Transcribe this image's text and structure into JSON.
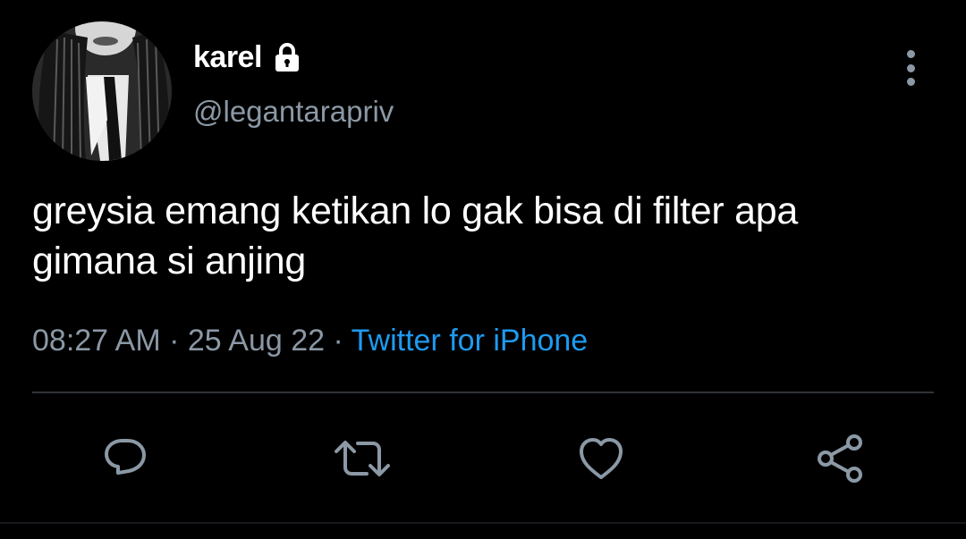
{
  "tweet": {
    "author": {
      "display_name": "karel",
      "handle": "@legantarapriv",
      "protected_icon": "lock-icon",
      "avatar": "profile-photo"
    },
    "text_line_1": "greysia emang ketikan lo gak bisa di filter apa",
    "text_line_2": "gimana si anjing",
    "time": "08:27 AM",
    "separator": "·",
    "date": "25 Aug 22",
    "source": "Twitter for iPhone"
  },
  "actions": [
    {
      "icon": "reply-icon"
    },
    {
      "icon": "retweet-icon"
    },
    {
      "icon": "like-icon"
    },
    {
      "icon": "share-icon"
    }
  ],
  "more_icon": "more-vertical-icon",
  "colors": {
    "background": "#000000",
    "text_primary": "#ffffff",
    "text_secondary": "#8b98a5",
    "link": "#1d9bf0",
    "divider": "#2f3336"
  }
}
